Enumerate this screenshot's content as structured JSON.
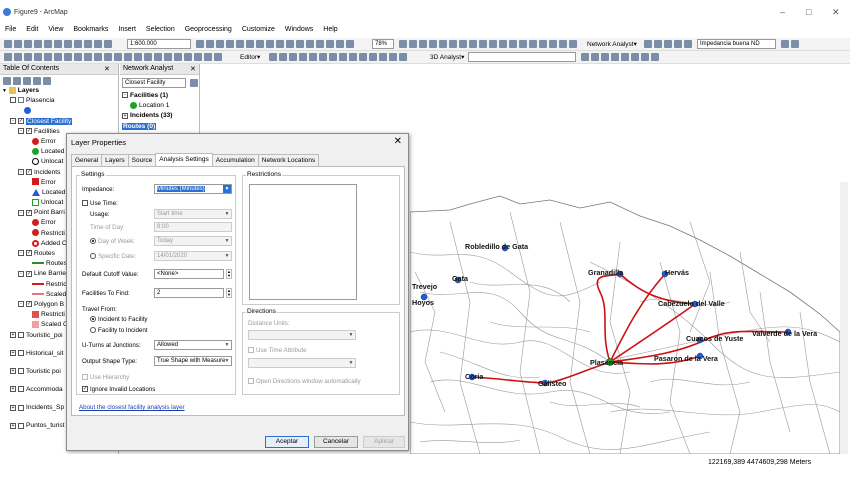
{
  "window": {
    "title": "Figure9 - ArcMap"
  },
  "menu": [
    "File",
    "Edit",
    "View",
    "Bookmarks",
    "Insert",
    "Selection",
    "Geoprocessing",
    "Customize",
    "Windows",
    "Help"
  ],
  "toolbar": {
    "scale": "1:600.000",
    "zoom": "78%",
    "network_analyst_label": "Network Analyst▾",
    "network_dataset": "Impedancia buena ND",
    "editor_label": "Editor▾",
    "analyst_3d_label": "3D Analyst▾"
  },
  "toc": {
    "title": "Table Of Contents",
    "layers_root": "Layers",
    "items": [
      "Plasencia",
      "Closest Facility",
      "Facilities",
      "Error",
      "Located",
      "Unlocat",
      "Incidents",
      "Error",
      "Located",
      "Unlocat",
      "Point Barri",
      "Error",
      "Restricti",
      "Added C",
      "Routes",
      "Routes",
      "Line Barrie",
      "Restricti",
      "Scaled C",
      "Polygon B",
      "Restricti",
      "Scaled C",
      "Touristic_poi",
      "Historical_sit",
      "Touristic poi",
      "Accommoda",
      "Incidents_Sp",
      "Puntos_turist"
    ]
  },
  "na_window": {
    "title": "Network Analyst",
    "analysis": "Closest Facility",
    "facilities": "Facilities (1)",
    "location1": "Location 1",
    "incidents": "Incidents (33)",
    "routes": "Routes (0)"
  },
  "dialog": {
    "title": "Layer Properties",
    "tabs": [
      "General",
      "Layers",
      "Source",
      "Analysis Settings",
      "Accumulation",
      "Network Locations"
    ],
    "settings_group": "Settings",
    "impedance_label": "Impedance:",
    "impedance_value": "Minutes (Minutes)",
    "use_time_label": "Use Time:",
    "usage_label": "Usage:",
    "usage_value": "Start time",
    "time_of_day_label": "Time of Day:",
    "time_of_day_value": "8:00",
    "day_of_week_label": "Day of Week:",
    "day_of_week_value": "Today",
    "specific_date_label": "Specific Date:",
    "specific_date_value": "14/01/2020",
    "cutoff_label": "Default Cutoff Value:",
    "cutoff_value": "<None>",
    "facilities_find_label": "Facilities To Find:",
    "facilities_find_value": "2",
    "travel_from_label": "Travel From:",
    "travel_opt1": "Incident to Facility",
    "travel_opt2": "Facility to Incident",
    "uturns_label": "U-Turns at Junctions:",
    "uturns_value": "Allowed",
    "output_shape_label": "Output Shape Type:",
    "output_shape_value": "True Shape with Measure",
    "use_hierarchy_label": "Use Hierarchy",
    "ignore_invalid_label": "Ignore Invalid Locations",
    "restrictions_group": "Restrictions",
    "directions_group": "Directions",
    "distance_units_label": "Distance Units:",
    "use_time_attr_label": "Use Time Attribute",
    "open_directions_label": "Open Directions window automatically",
    "about_link": "About the closest facility analysis layer",
    "accept": "Aceptar",
    "cancel": "Cancelar",
    "apply": "Aplicar"
  },
  "map": {
    "labels": [
      "Robledillo de Gata",
      "Trevejo",
      "Gata",
      "Hoyos",
      "Granadilla",
      "Hervás",
      "Cabezuelo del Valle",
      "Valverde de la Vera",
      "Cuacos de Yuste",
      "Pasaron de la Vera",
      "Plasencia",
      "Coria",
      "Galisteo"
    ]
  },
  "status": {
    "coords": "122169,389  4474609,298 Meters"
  }
}
